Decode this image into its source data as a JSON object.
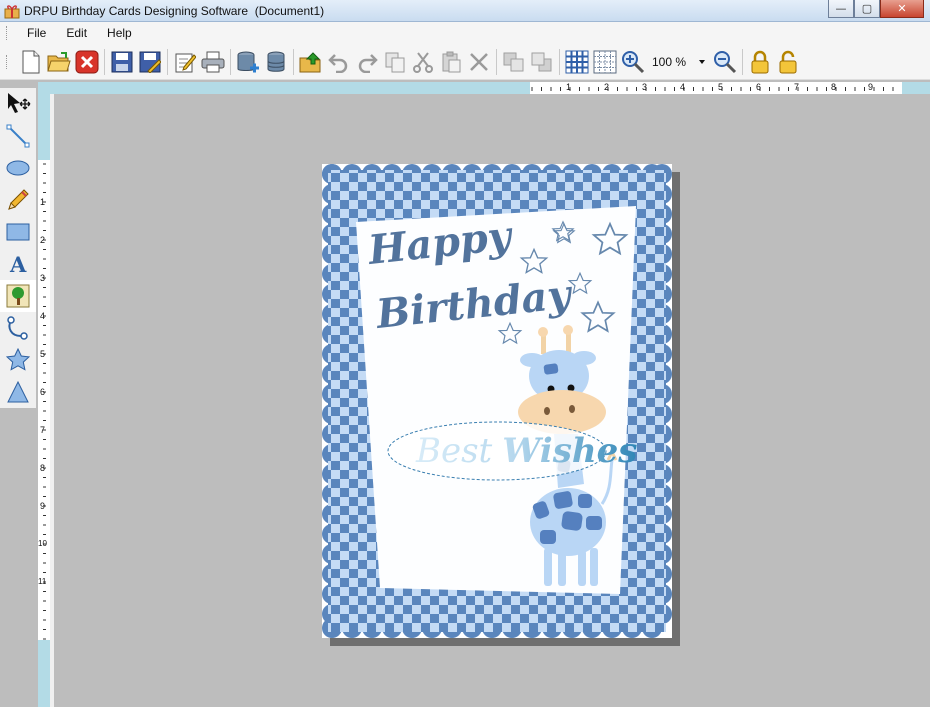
{
  "window": {
    "title": "DRPU Birthday Cards Designing Software  (Document1)",
    "controls": {
      "minimize": "—",
      "maximize": "▢",
      "close": "✕"
    }
  },
  "menu": {
    "items": [
      "File",
      "Edit",
      "Help"
    ]
  },
  "toolbar": {
    "zoom_value": "100 %",
    "buttons": [
      "new-icon",
      "open-icon",
      "close-document-icon",
      "save-icon",
      "save-as-icon",
      "edit-icon",
      "print-icon",
      "database-add-icon",
      "database-icon",
      "export-icon",
      "undo-icon",
      "redo-icon",
      "copy-icon",
      "cut-icon",
      "paste-icon",
      "delete-icon",
      "bring-forward-icon",
      "send-backward-icon",
      "grid-icon",
      "grid-alt-icon",
      "zoom-in-icon",
      "zoom-out-icon",
      "lock-icon",
      "unlock-icon"
    ]
  },
  "tools": [
    "select-move-tool",
    "line-tool",
    "ellipse-tool",
    "pencil-tool",
    "rectangle-tool",
    "text-tool",
    "picture-tool",
    "curve-tool",
    "star-tool",
    "triangle-tool"
  ],
  "rulers": {
    "horizontal": [
      "1",
      "2",
      "3",
      "4",
      "5",
      "6",
      "7",
      "8",
      "9"
    ],
    "vertical": [
      "1",
      "2",
      "3",
      "4",
      "5",
      "6",
      "7",
      "8",
      "9",
      "10",
      "11"
    ]
  },
  "card": {
    "line1": "Happy",
    "line2": "Birthday",
    "wishes_part1": "Best",
    "wishes_part2": "Wishes",
    "colors": {
      "check_dark": "#5a86bd",
      "check_light": "#c4dbf5",
      "text_blue": "#52739c",
      "giraffe_blue": "#b9d6f5",
      "giraffe_spot": "#5580bf",
      "giraffe_face": "#f7d7ae"
    }
  }
}
